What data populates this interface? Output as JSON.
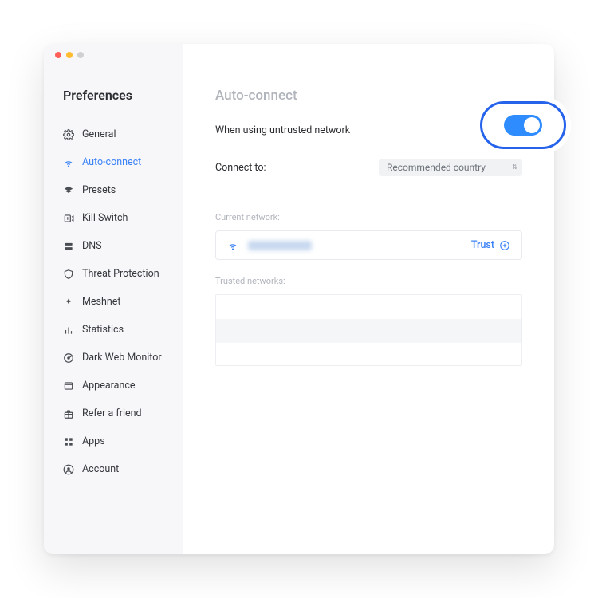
{
  "window": {
    "title": "Preferences"
  },
  "sidebar": {
    "items": [
      {
        "icon": "gear-icon",
        "label": "General"
      },
      {
        "icon": "wifi-icon",
        "label": "Auto-connect"
      },
      {
        "icon": "layers-icon",
        "label": "Presets"
      },
      {
        "icon": "power-icon",
        "label": "Kill Switch"
      },
      {
        "icon": "server-icon",
        "label": "DNS"
      },
      {
        "icon": "shield-icon",
        "label": "Threat Protection"
      },
      {
        "icon": "mesh-icon",
        "label": "Meshnet"
      },
      {
        "icon": "bars-icon",
        "label": "Statistics"
      },
      {
        "icon": "radar-icon",
        "label": "Dark Web Monitor"
      },
      {
        "icon": "window-icon",
        "label": "Appearance"
      },
      {
        "icon": "gift-icon",
        "label": "Refer a friend"
      },
      {
        "icon": "grid-icon",
        "label": "Apps"
      },
      {
        "icon": "account-icon",
        "label": "Account"
      }
    ],
    "active_index": 1
  },
  "main": {
    "heading": "Auto-connect",
    "untrusted_label": "When using untrusted network",
    "toggle_on": true,
    "connect_to_label": "Connect to:",
    "connect_to_value": "Recommended country",
    "current_network_label": "Current network:",
    "current_network_name": "",
    "trust_label": "Trust",
    "trusted_networks_label": "Trusted networks:"
  },
  "colors": {
    "accent": "#3b82f6",
    "sidebar_bg": "#f7f7f9",
    "muted_text": "#b0b4bb"
  }
}
